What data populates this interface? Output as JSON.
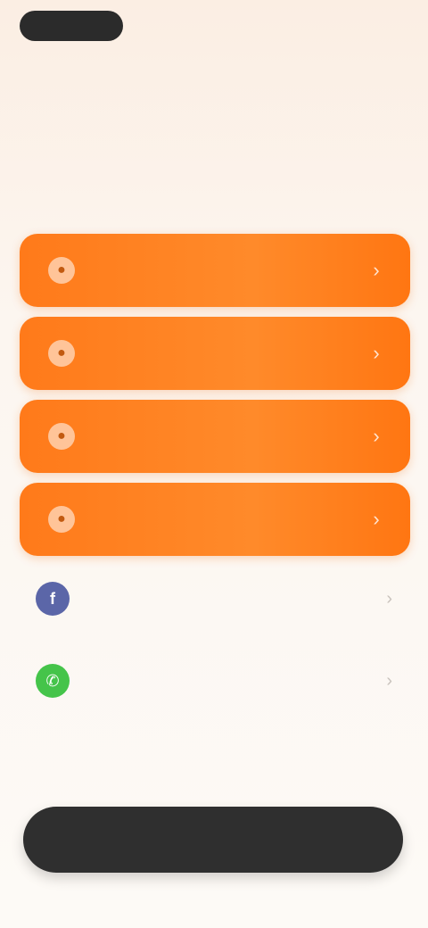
{
  "header": {
    "left_pill": "",
    "right_text": ""
  },
  "tagline": "",
  "headline": {
    "accent": "",
    "rest": ""
  },
  "options": [
    {
      "label": "",
      "icon": "app-icon",
      "chevron": "›"
    },
    {
      "label": "",
      "icon": "app-icon",
      "chevron": "›"
    },
    {
      "label": "",
      "icon": "app-icon",
      "chevron": "›"
    },
    {
      "label": "",
      "icon": "app-icon",
      "chevron": "›"
    }
  ],
  "alternatives": [
    {
      "label": "",
      "icon": "facebook-icon",
      "glyph": "f",
      "chevron": "›"
    },
    {
      "label": "",
      "icon": "whatsapp-icon",
      "glyph": "✆",
      "chevron": "›"
    }
  ],
  "cta": {
    "label": ""
  },
  "colors": {
    "accent_orange": "#ff7a1a",
    "facebook_blue": "#5b66a8",
    "whatsapp_green": "#45c44a",
    "cta_dark": "#2f2f2f"
  }
}
